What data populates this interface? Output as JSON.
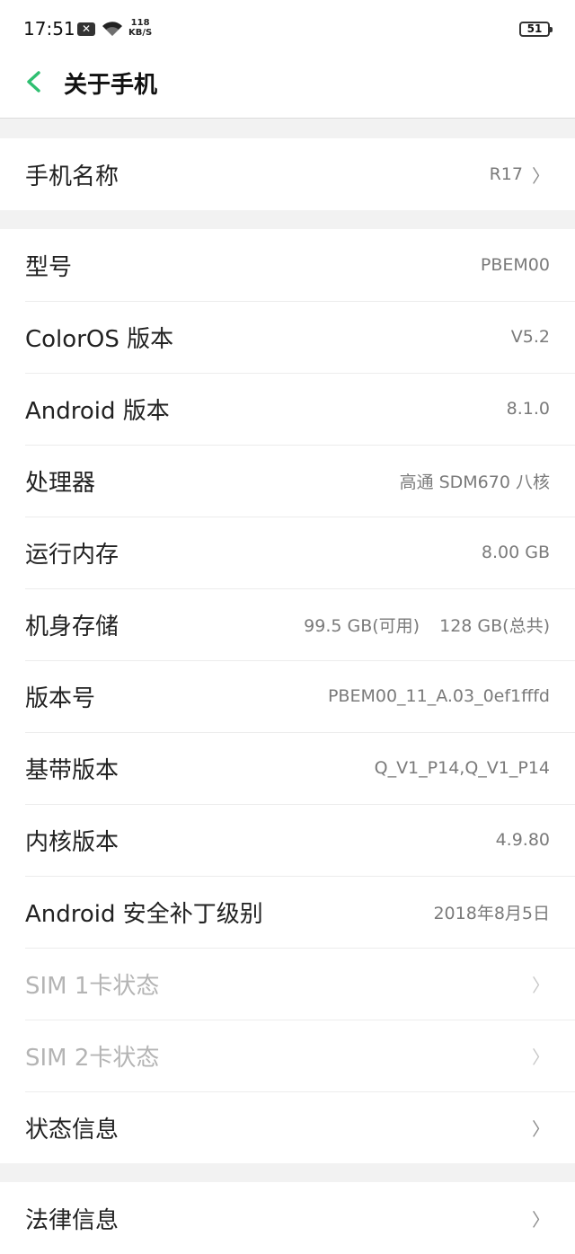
{
  "status_bar": {
    "time": "17:51",
    "net_speed_value": "118",
    "net_speed_unit": "KB/S",
    "battery": "51"
  },
  "header": {
    "title": "关于手机"
  },
  "group1": {
    "phone_name_label": "手机名称",
    "phone_name_value": "R17"
  },
  "info": {
    "model_label": "型号",
    "model_value": "PBEM00",
    "coloros_label": "ColorOS 版本",
    "coloros_value": "V5.2",
    "android_label": "Android 版本",
    "android_value": "8.1.0",
    "cpu_label": "处理器",
    "cpu_value": "高通 SDM670 八核",
    "ram_label": "运行内存",
    "ram_value": "8.00 GB",
    "storage_label": "机身存储",
    "storage_available": "99.5 GB(可用)",
    "storage_total": "128 GB(总共)",
    "build_label": "版本号",
    "build_value": "PBEM00_11_A.03_0ef1fffd",
    "baseband_label": "基带版本",
    "baseband_value": "Q_V1_P14,Q_V1_P14",
    "kernel_label": "内核版本",
    "kernel_value": "4.9.80",
    "security_label": "Android 安全补丁级别",
    "security_value": "2018年8月5日",
    "sim1_label": "SIM 1卡状态",
    "sim2_label": "SIM 2卡状态",
    "status_label": "状态信息"
  },
  "group3": {
    "legal_label": "法律信息"
  },
  "chevron": "〉"
}
